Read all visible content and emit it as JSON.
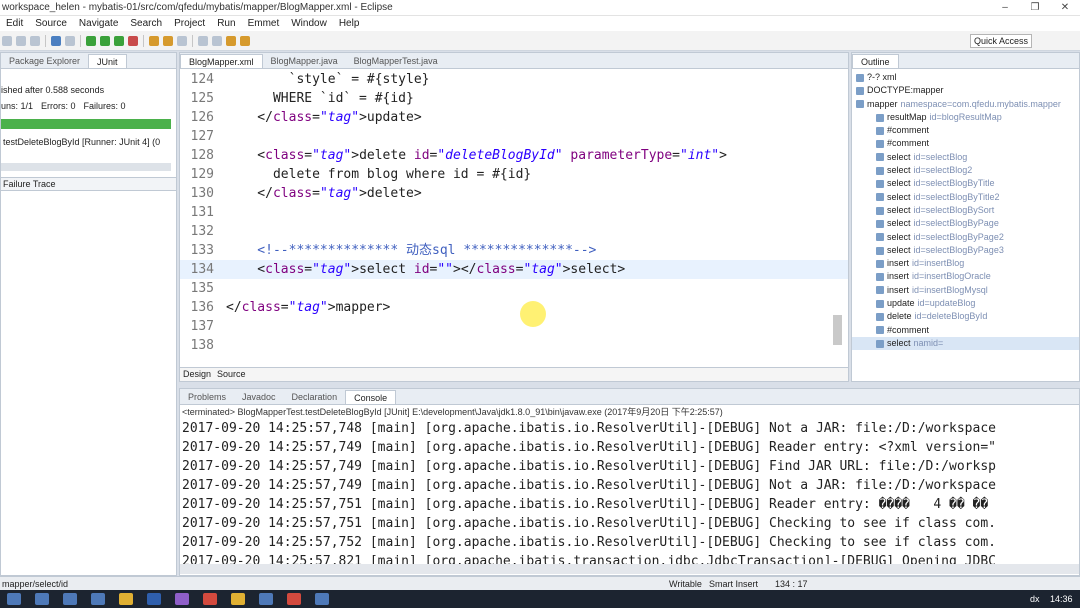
{
  "window": {
    "title": "workspace_helen - mybatis-01/src/com/qfedu/mybatis/mapper/BlogMapper.xml - Eclipse"
  },
  "menu": [
    "Edit",
    "Source",
    "Navigate",
    "Search",
    "Project",
    "Run",
    "Emmet",
    "Window",
    "Help"
  ],
  "toolbar": {
    "quick_access": "Quick Access"
  },
  "left_panel": {
    "tabs": [
      "Package Explorer",
      "JUnit"
    ],
    "finished": "ished after 0.588 seconds",
    "runs": "uns:  1/1",
    "errors": "Errors:  0",
    "failures": "Failures:  0",
    "test_item": "testDeleteBlogById [Runner: JUnit 4] (0",
    "failure_trace": "Failure Trace"
  },
  "editor": {
    "tabs": [
      "BlogMapper.xml",
      "BlogMapper.java",
      "BlogMapperTest.java"
    ],
    "lines": [
      {
        "n": "124",
        "html": "        `style` = #{style}"
      },
      {
        "n": "125",
        "html": "      WHERE `id` = #{id}"
      },
      {
        "n": "126",
        "html": "    </update>"
      },
      {
        "n": "127",
        "html": ""
      },
      {
        "n": "128",
        "html": "    <delete id=\"deleteBlogById\" parameterType=\"int\">"
      },
      {
        "n": "129",
        "html": "      delete from blog where id = #{id}"
      },
      {
        "n": "130",
        "html": "    </delete>"
      },
      {
        "n": "131",
        "html": ""
      },
      {
        "n": "132",
        "html": ""
      },
      {
        "n": "133",
        "html": "    <!--************** 动态sql **************-->"
      },
      {
        "n": "134",
        "html": "    <select id=\"\"></select>"
      },
      {
        "n": "135",
        "html": ""
      },
      {
        "n": "136",
        "html": "</mapper>"
      },
      {
        "n": "137",
        "html": ""
      },
      {
        "n": "138",
        "html": ""
      }
    ],
    "bottom_tabs": [
      "Design",
      "Source"
    ]
  },
  "outline": {
    "tab": "Outline",
    "items": [
      {
        "text": "?-? xml",
        "sub": "",
        "indent": 0
      },
      {
        "text": "DOCTYPE:mapper",
        "sub": "",
        "indent": 0
      },
      {
        "text": "mapper",
        "sub": "namespace=com.qfedu.mybatis.mapper",
        "indent": 0
      },
      {
        "text": "resultMap",
        "sub": "id=blogResultMap",
        "indent": 1
      },
      {
        "text": "#comment",
        "sub": "",
        "indent": 1
      },
      {
        "text": "#comment",
        "sub": "",
        "indent": 1
      },
      {
        "text": "select",
        "sub": "id=selectBlog",
        "indent": 1
      },
      {
        "text": "select",
        "sub": "id=selectBlog2",
        "indent": 1
      },
      {
        "text": "select",
        "sub": "id=selectBlogByTitle",
        "indent": 1
      },
      {
        "text": "select",
        "sub": "id=selectBlogByTitle2",
        "indent": 1
      },
      {
        "text": "select",
        "sub": "id=selectBlogBySort",
        "indent": 1
      },
      {
        "text": "select",
        "sub": "id=selectBlogByPage",
        "indent": 1
      },
      {
        "text": "select",
        "sub": "id=selectBlogByPage2",
        "indent": 1
      },
      {
        "text": "select",
        "sub": "id=selectBlogByPage3",
        "indent": 1
      },
      {
        "text": "insert",
        "sub": "id=insertBlog",
        "indent": 1
      },
      {
        "text": "insert",
        "sub": "id=insertBlogOracle",
        "indent": 1
      },
      {
        "text": "insert",
        "sub": "id=insertBlogMysql",
        "indent": 1
      },
      {
        "text": "update",
        "sub": "id=updateBlog",
        "indent": 1
      },
      {
        "text": "delete",
        "sub": "id=deleteBlogById",
        "indent": 1
      },
      {
        "text": "#comment",
        "sub": "",
        "indent": 1
      },
      {
        "text": "select",
        "sub": "namid=",
        "indent": 1
      }
    ]
  },
  "console": {
    "tabs": [
      "Problems",
      "Javadoc",
      "Declaration",
      "Console"
    ],
    "status": "<terminated> BlogMapperTest.testDeleteBlogById [JUnit] E:\\development\\Java\\jdk1.8.0_91\\bin\\javaw.exe (2017年9月20日 下午2:25:57)",
    "lines": [
      "2017-09-20 14:25:57,748 [main] [org.apache.ibatis.io.ResolverUtil]-[DEBUG] Not a JAR: file:/D:/workspace",
      "2017-09-20 14:25:57,749 [main] [org.apache.ibatis.io.ResolverUtil]-[DEBUG] Reader entry: <?xml version=\"",
      "2017-09-20 14:25:57,749 [main] [org.apache.ibatis.io.ResolverUtil]-[DEBUG] Find JAR URL: file:/D:/worksp",
      "2017-09-20 14:25:57,749 [main] [org.apache.ibatis.io.ResolverUtil]-[DEBUG] Not a JAR: file:/D:/workspace",
      "2017-09-20 14:25:57,751 [main] [org.apache.ibatis.io.ResolverUtil]-[DEBUG] Reader entry: ����   4 �� ��",
      "2017-09-20 14:25:57,751 [main] [org.apache.ibatis.io.ResolverUtil]-[DEBUG] Checking to see if class com.",
      "2017-09-20 14:25:57,752 [main] [org.apache.ibatis.io.ResolverUtil]-[DEBUG] Checking to see if class com.",
      "2017-09-20 14:25:57,821 [main] [org.apache.ibatis.transaction.jdbc.JdbcTransaction]-[DEBUG] Opening JDBC"
    ]
  },
  "statusbar": {
    "path": "mapper/select/id",
    "writable": "Writable",
    "insert": "Smart Insert",
    "pos": "134 : 17"
  },
  "taskbar": {
    "time": "14:36",
    "lang": "dx"
  }
}
